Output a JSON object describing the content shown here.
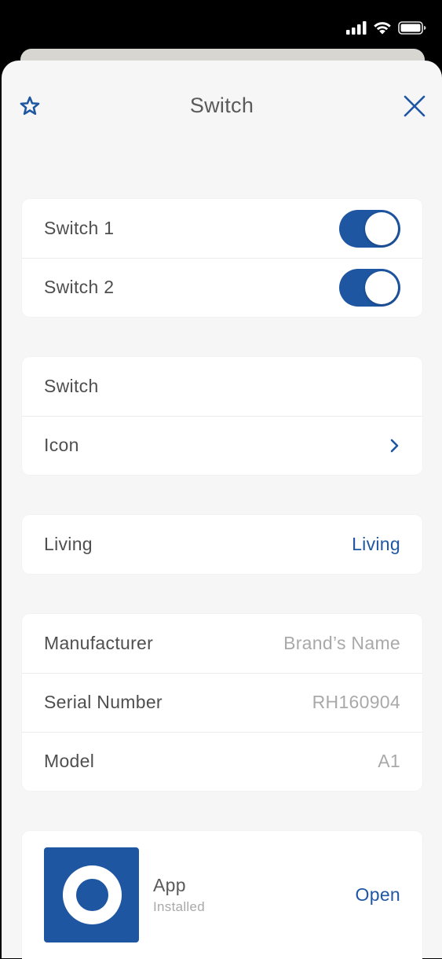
{
  "header": {
    "title": "Switch"
  },
  "switches": [
    {
      "label": "Switch 1",
      "on": true
    },
    {
      "label": "Switch 2",
      "on": true
    }
  ],
  "settings": {
    "name_label": "Switch",
    "icon_label": "Icon"
  },
  "room": {
    "label": "Living",
    "value": "Living"
  },
  "info": {
    "manufacturer_label": "Manufacturer",
    "manufacturer_value": "Brand’s Name",
    "serial_label": "Serial Number",
    "serial_value": "RH160904",
    "model_label": "Model",
    "model_value": "A1"
  },
  "app": {
    "name": "App",
    "status": "Installed",
    "action_label": "Open"
  },
  "icons": {
    "star": "star-icon",
    "close": "close-icon",
    "chevron": "chevron-right-icon",
    "signal": "cellular-signal-icon",
    "wifi": "wifi-icon",
    "battery": "battery-icon"
  },
  "colors": {
    "accent": "#1e56a2",
    "sheet_background": "#f6f6f6",
    "card_background": "#ffffff",
    "primary_text": "#4f4f4f",
    "secondary_text": "#a9a9a9"
  }
}
